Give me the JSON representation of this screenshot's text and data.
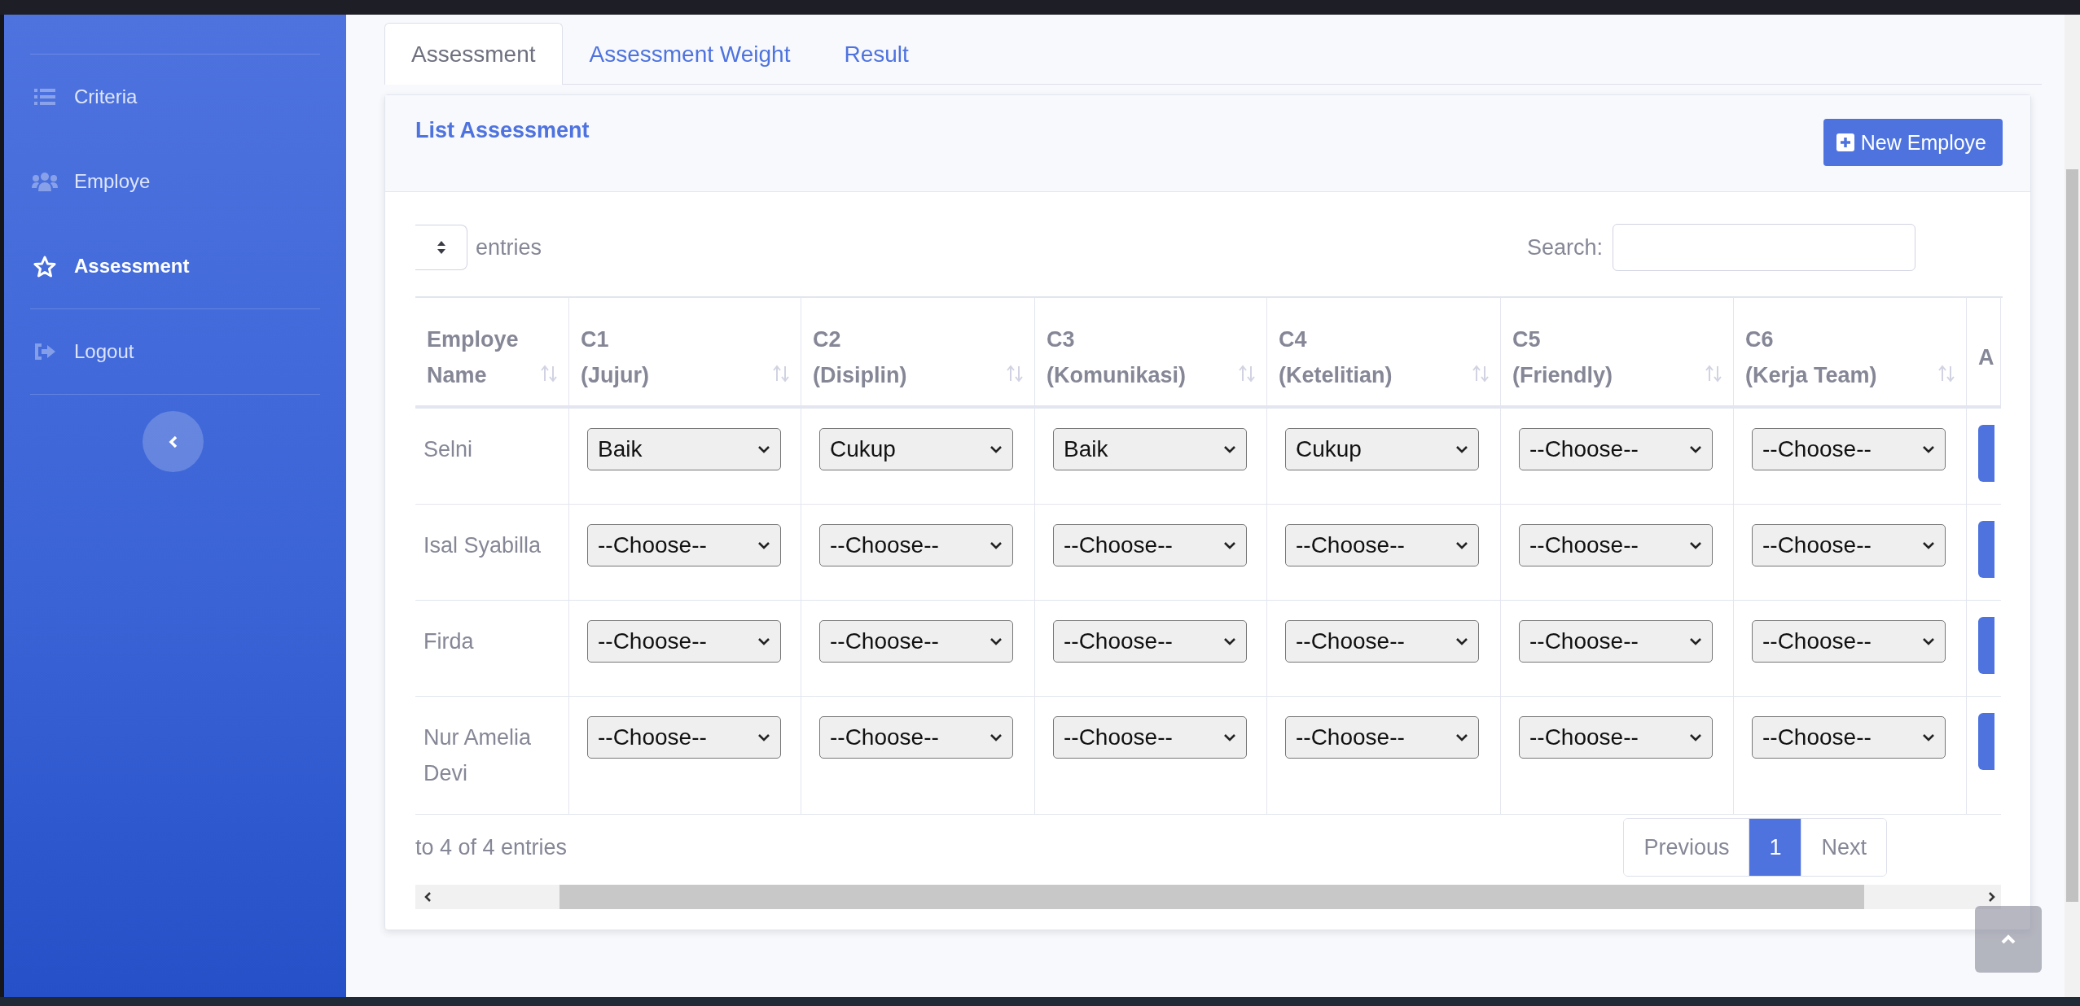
{
  "sidebar": {
    "items": [
      {
        "label": "Criteria",
        "selected": false
      },
      {
        "label": "Employe",
        "selected": false
      },
      {
        "label": "Assessment",
        "selected": true
      },
      {
        "label": "Logout",
        "selected": false
      }
    ]
  },
  "tabs": [
    {
      "label": "Assessment",
      "selected": true
    },
    {
      "label": "Assessment Weight",
      "selected": false
    },
    {
      "label": "Result",
      "selected": false
    }
  ],
  "card": {
    "title": "List Assessment",
    "new_button": "New Employe"
  },
  "length_label": "entries",
  "search": {
    "label": "Search:"
  },
  "table": {
    "columns": [
      {
        "code": "Employe",
        "label": "Name"
      },
      {
        "code": "C1",
        "label": "(Jujur)"
      },
      {
        "code": "C2",
        "label": "(Disiplin)"
      },
      {
        "code": "C3",
        "label": "(Komunikasi)"
      },
      {
        "code": "C4",
        "label": "(Ketelitian)"
      },
      {
        "code": "C5",
        "label": "(Friendly)"
      },
      {
        "code": "C6",
        "label": "(Kerja Team)"
      },
      {
        "code": "A"
      }
    ],
    "rows": [
      {
        "name": "Selni",
        "values": [
          "Baik",
          "Cukup",
          "Baik",
          "Cukup",
          "--Choose--",
          "--Choose--"
        ]
      },
      {
        "name": "Isal Syabilla",
        "values": [
          "--Choose--",
          "--Choose--",
          "--Choose--",
          "--Choose--",
          "--Choose--",
          "--Choose--"
        ]
      },
      {
        "name": "Firda",
        "values": [
          "--Choose--",
          "--Choose--",
          "--Choose--",
          "--Choose--",
          "--Choose--",
          "--Choose--"
        ]
      },
      {
        "name": "Nur Amelia Devi",
        "values": [
          "--Choose--",
          "--Choose--",
          "--Choose--",
          "--Choose--",
          "--Choose--",
          "--Choose--"
        ]
      }
    ]
  },
  "info": "to 4 of 4 entries",
  "pagination": [
    {
      "label": "Previous",
      "selected": false
    },
    {
      "label": "1",
      "selected": true
    },
    {
      "label": "Next",
      "selected": false
    }
  ]
}
